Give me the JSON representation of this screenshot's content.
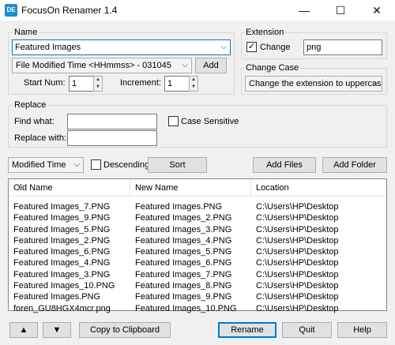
{
  "window": {
    "icon_text": "DE",
    "title": "FocusOn Renamer 1.4",
    "minimize": "—",
    "maximize": "☐",
    "close": "✕"
  },
  "name_group": {
    "label": "Name",
    "name_value": "Featured Images",
    "format_value": "File Modified Time <HHmmss> - 031045",
    "add_button": "Add",
    "start_num_label": "Start Num:",
    "start_num_value": "1",
    "increment_label": "Increment:",
    "increment_value": "1"
  },
  "extension_group": {
    "label": "Extension",
    "change_checked": true,
    "change_label": "Change",
    "extension_value": "png"
  },
  "change_case_group": {
    "label": "Change Case",
    "selected": "Change the extension to uppercase"
  },
  "replace_group": {
    "label": "Replace",
    "find_label": "Find what:",
    "find_value": "",
    "replace_label": "Replace with:",
    "replace_value": "",
    "case_sensitive_label": "Case Sensitive",
    "case_sensitive_checked": false
  },
  "sort_bar": {
    "sort_by": "Modified Time",
    "descending_label": "Descending",
    "descending_checked": false,
    "sort_button": "Sort",
    "add_files_button": "Add Files",
    "add_folder_button": "Add Folder"
  },
  "file_list": {
    "columns": [
      "Old Name",
      "New Name",
      "Location"
    ],
    "rows": [
      [
        "Featured Images_7.PNG",
        "Featured Images.PNG",
        "C:\\Users\\HP\\Desktop"
      ],
      [
        "Featured Images_9.PNG",
        "Featured Images_2.PNG",
        "C:\\Users\\HP\\Desktop"
      ],
      [
        "Featured Images_5.PNG",
        "Featured Images_3.PNG",
        "C:\\Users\\HP\\Desktop"
      ],
      [
        "Featured Images_2.PNG",
        "Featured Images_4.PNG",
        "C:\\Users\\HP\\Desktop"
      ],
      [
        "Featured Images_6.PNG",
        "Featured Images_5.PNG",
        "C:\\Users\\HP\\Desktop"
      ],
      [
        "Featured Images_4.PNG",
        "Featured Images_6.PNG",
        "C:\\Users\\HP\\Desktop"
      ],
      [
        "Featured Images_3.PNG",
        "Featured Images_7.PNG",
        "C:\\Users\\HP\\Desktop"
      ],
      [
        "Featured Images_10.PNG",
        "Featured Images_8.PNG",
        "C:\\Users\\HP\\Desktop"
      ],
      [
        "Featured Images.PNG",
        "Featured Images_9.PNG",
        "C:\\Users\\HP\\Desktop"
      ],
      [
        "foren_GU8HGX4mcr.png",
        "Featured Images_10.PNG",
        "C:\\Users\\HP\\Desktop"
      ]
    ]
  },
  "bottom_bar": {
    "up_button": "▲",
    "down_button": "▼",
    "copy_button": "Copy to Clipboard",
    "rename_button": "Rename",
    "quit_button": "Quit",
    "help_button": "Help"
  }
}
